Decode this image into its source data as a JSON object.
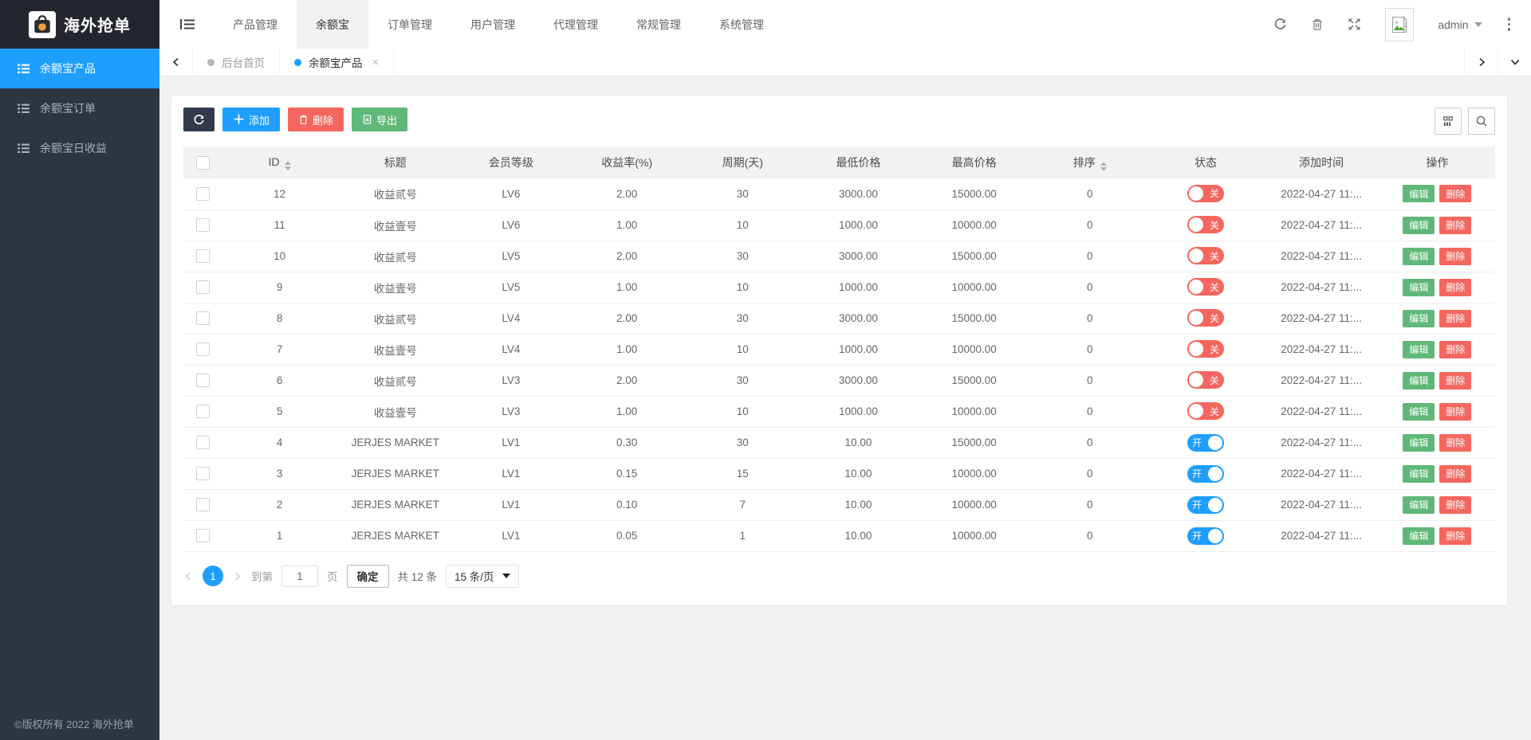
{
  "app": {
    "title": "海外抢单",
    "copyright": "©版权所有 2022 海外抢单"
  },
  "header": {
    "nav": [
      {
        "label": "产品管理",
        "active": false
      },
      {
        "label": "余额宝",
        "active": true
      },
      {
        "label": "订单管理",
        "active": false
      },
      {
        "label": "用户管理",
        "active": false
      },
      {
        "label": "代理管理",
        "active": false
      },
      {
        "label": "常规管理",
        "active": false
      },
      {
        "label": "系统管理",
        "active": false
      }
    ],
    "user": "admin",
    "icons": [
      "refresh-icon",
      "trash-icon",
      "fullscreen-icon",
      "avatar",
      "more-vert-icon"
    ]
  },
  "sidebar": {
    "items": [
      {
        "label": "余额宝产品",
        "active": true
      },
      {
        "label": "余额宝订单",
        "active": false
      },
      {
        "label": "余额宝日收益",
        "active": false
      }
    ]
  },
  "tabs": [
    {
      "label": "后台首页",
      "active": false,
      "closable": false
    },
    {
      "label": "余额宝产品",
      "active": true,
      "closable": true
    }
  ],
  "toolbar": {
    "add": "添加",
    "delete": "删除",
    "export": "导出"
  },
  "table": {
    "columns": [
      {
        "label": "ID",
        "sortable": true
      },
      {
        "label": "标题",
        "sortable": false
      },
      {
        "label": "会员等级",
        "sortable": false
      },
      {
        "label": "收益率(%)",
        "sortable": false
      },
      {
        "label": "周期(天)",
        "sortable": false
      },
      {
        "label": "最低价格",
        "sortable": false
      },
      {
        "label": "最高价格",
        "sortable": false
      },
      {
        "label": "排序",
        "sortable": true
      },
      {
        "label": "状态",
        "sortable": false
      },
      {
        "label": "添加时间",
        "sortable": false
      },
      {
        "label": "操作",
        "sortable": false
      }
    ],
    "status_on": "开",
    "status_off": "关",
    "action_edit": "编辑",
    "action_delete": "删除",
    "rows": [
      {
        "id": "12",
        "title": "收益贰号",
        "level": "LV6",
        "rate": "2.00",
        "cycle": "30",
        "min_price": "3000.00",
        "max_price": "15000.00",
        "sort": "0",
        "status": "off",
        "time": "2022-04-27 11:..."
      },
      {
        "id": "11",
        "title": "收益壹号",
        "level": "LV6",
        "rate": "1.00",
        "cycle": "10",
        "min_price": "1000.00",
        "max_price": "10000.00",
        "sort": "0",
        "status": "off",
        "time": "2022-04-27 11:..."
      },
      {
        "id": "10",
        "title": "收益贰号",
        "level": "LV5",
        "rate": "2.00",
        "cycle": "30",
        "min_price": "3000.00",
        "max_price": "15000.00",
        "sort": "0",
        "status": "off",
        "time": "2022-04-27 11:..."
      },
      {
        "id": "9",
        "title": "收益壹号",
        "level": "LV5",
        "rate": "1.00",
        "cycle": "10",
        "min_price": "1000.00",
        "max_price": "10000.00",
        "sort": "0",
        "status": "off",
        "time": "2022-04-27 11:..."
      },
      {
        "id": "8",
        "title": "收益贰号",
        "level": "LV4",
        "rate": "2.00",
        "cycle": "30",
        "min_price": "3000.00",
        "max_price": "15000.00",
        "sort": "0",
        "status": "off",
        "time": "2022-04-27 11:..."
      },
      {
        "id": "7",
        "title": "收益壹号",
        "level": "LV4",
        "rate": "1.00",
        "cycle": "10",
        "min_price": "1000.00",
        "max_price": "10000.00",
        "sort": "0",
        "status": "off",
        "time": "2022-04-27 11:..."
      },
      {
        "id": "6",
        "title": "收益贰号",
        "level": "LV3",
        "rate": "2.00",
        "cycle": "30",
        "min_price": "3000.00",
        "max_price": "15000.00",
        "sort": "0",
        "status": "off",
        "time": "2022-04-27 11:..."
      },
      {
        "id": "5",
        "title": "收益壹号",
        "level": "LV3",
        "rate": "1.00",
        "cycle": "10",
        "min_price": "1000.00",
        "max_price": "10000.00",
        "sort": "0",
        "status": "off",
        "time": "2022-04-27 11:..."
      },
      {
        "id": "4",
        "title": "JERJES MARKET",
        "level": "LV1",
        "rate": "0.30",
        "cycle": "30",
        "min_price": "10.00",
        "max_price": "15000.00",
        "sort": "0",
        "status": "on",
        "time": "2022-04-27 11:..."
      },
      {
        "id": "3",
        "title": "JERJES MARKET",
        "level": "LV1",
        "rate": "0.15",
        "cycle": "15",
        "min_price": "10.00",
        "max_price": "10000.00",
        "sort": "0",
        "status": "on",
        "time": "2022-04-27 11:..."
      },
      {
        "id": "2",
        "title": "JERJES MARKET",
        "level": "LV1",
        "rate": "0.10",
        "cycle": "7",
        "min_price": "10.00",
        "max_price": "10000.00",
        "sort": "0",
        "status": "on",
        "time": "2022-04-27 11:..."
      },
      {
        "id": "1",
        "title": "JERJES MARKET",
        "level": "LV1",
        "rate": "0.05",
        "cycle": "1",
        "min_price": "10.00",
        "max_price": "10000.00",
        "sort": "0",
        "status": "on",
        "time": "2022-04-27 11:..."
      }
    ]
  },
  "pagination": {
    "page": "1",
    "goto_label": "到第",
    "goto_value": "1",
    "page_label": "页",
    "confirm": "确定",
    "total": "共 12 条",
    "per_page": "15 条/页"
  },
  "colors": {
    "accent": "#1E9FFF",
    "danger": "#F5665F",
    "success": "#5FB878",
    "dark_button": "#313B4B",
    "sidebar_bg": "#2E3440",
    "logo_bg": "#23262E"
  }
}
